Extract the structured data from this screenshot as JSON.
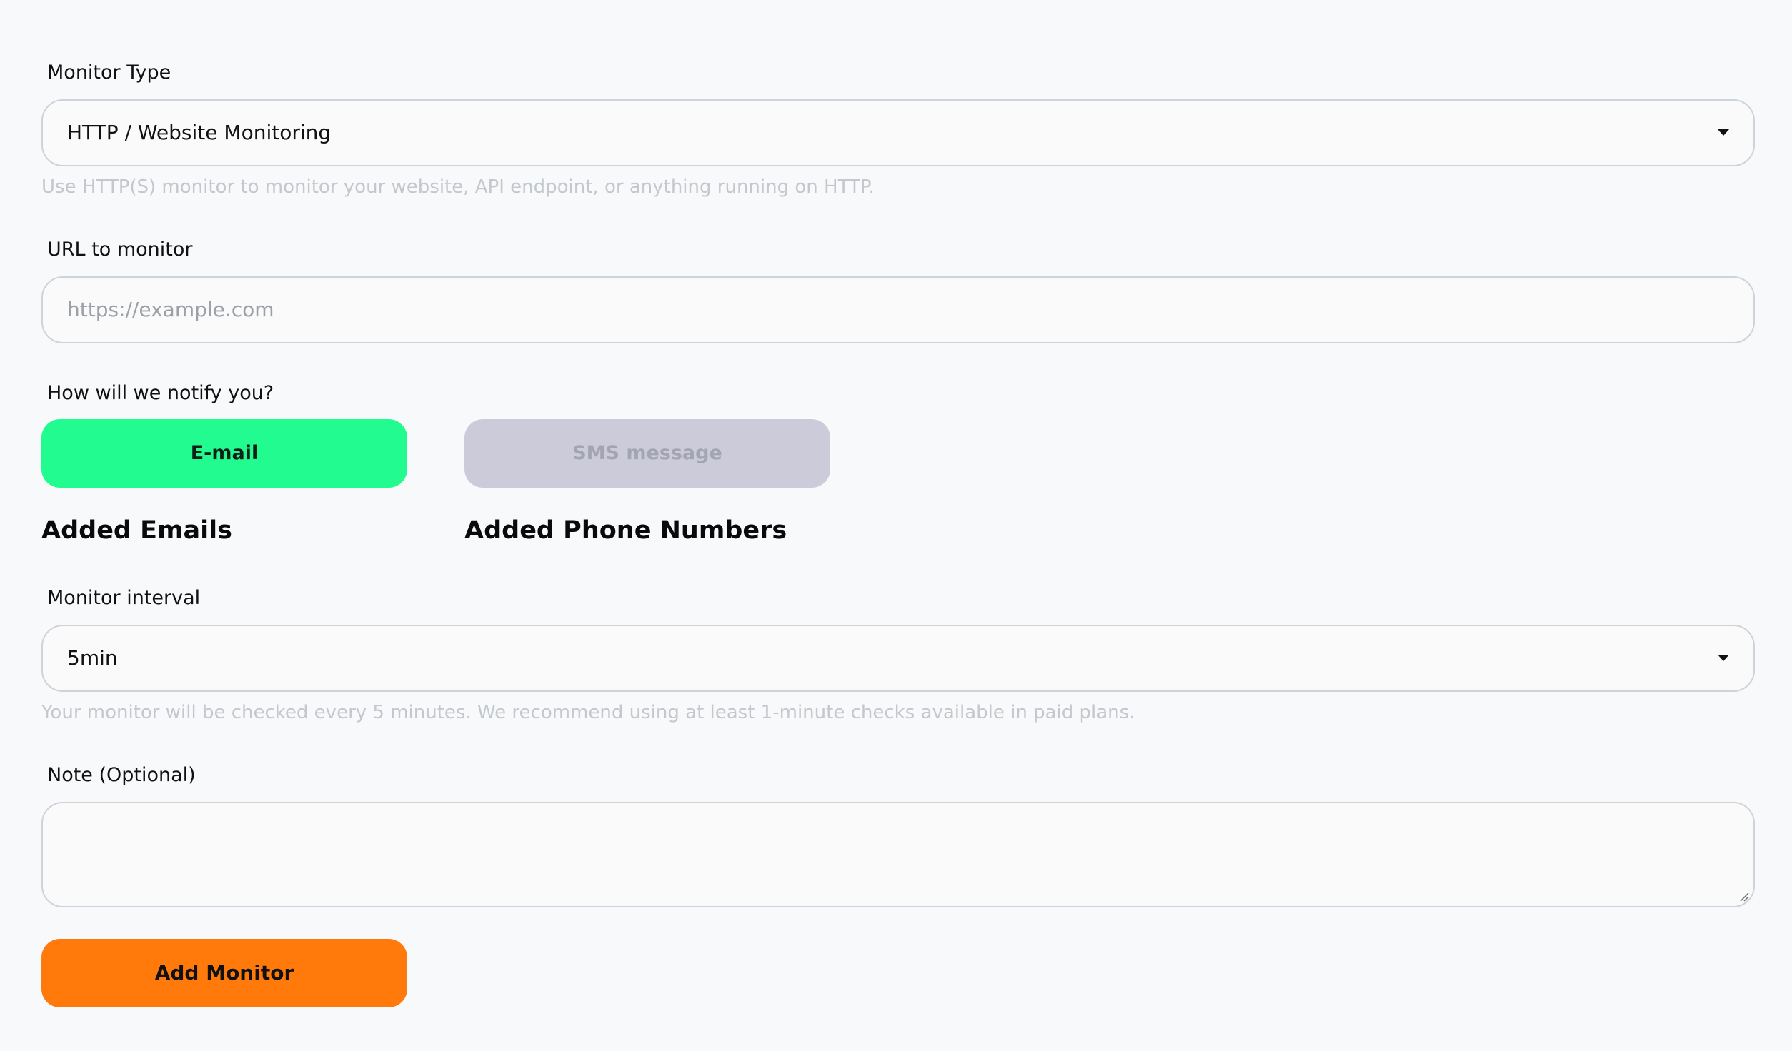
{
  "monitor_type": {
    "label": "Monitor Type",
    "selected": "HTTP / Website Monitoring",
    "help": "Use HTTP(S) monitor to monitor your website, API endpoint, or anything running on HTTP."
  },
  "url": {
    "label": "URL to monitor",
    "placeholder": "https://example.com",
    "value": ""
  },
  "notify": {
    "label": "How will we notify you?",
    "email_button": "E-mail",
    "sms_button": "SMS message",
    "email_selected": true,
    "added_emails_title": "Added Emails",
    "added_phones_title": "Added Phone Numbers"
  },
  "interval": {
    "label": "Monitor interval",
    "selected": "5min",
    "help": "Your monitor will be checked every 5 minutes. We recommend using at least 1-minute checks available in paid plans."
  },
  "note": {
    "label": "Note (Optional)",
    "value": ""
  },
  "submit": {
    "label": "Add Monitor"
  },
  "colors": {
    "email_active": "#22fb8f",
    "sms_inactive": "#cccbd9",
    "submit": "#ff7a0b",
    "background": "#f8f9fa"
  },
  "icons": {
    "dropdown": "caret-down-icon",
    "textarea_resize": "resize-handle-icon"
  }
}
